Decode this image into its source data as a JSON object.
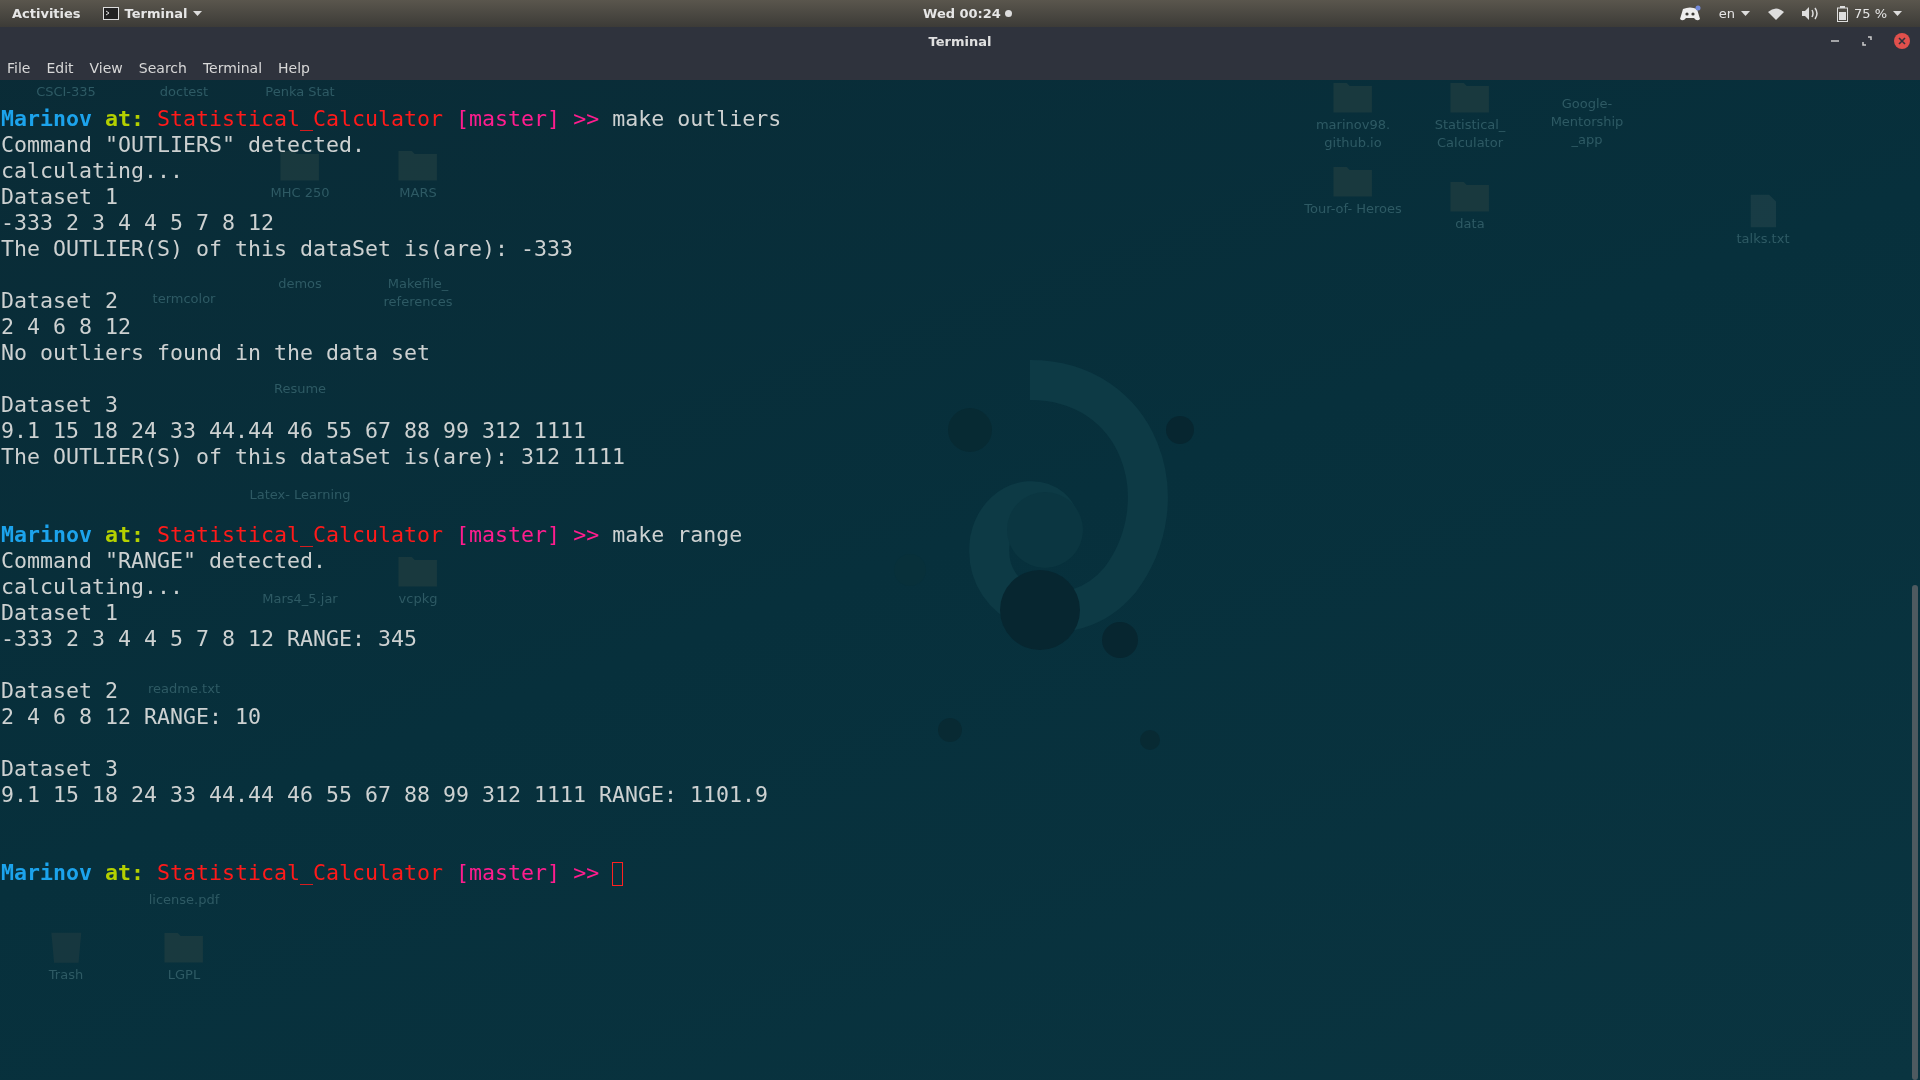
{
  "top_bar": {
    "activities": "Activities",
    "app_menu": "Terminal",
    "clock": "Wed 00:24",
    "keyboard_layout": "en",
    "battery": "75 %"
  },
  "window": {
    "title": "Terminal",
    "menu": [
      "File",
      "Edit",
      "View",
      "Search",
      "Terminal",
      "Help"
    ]
  },
  "terminal": {
    "lines": [
      {
        "kind": "prompt",
        "user": "Marinov",
        "at": "at:",
        "directory": "Statistical_Calculator",
        "branch": "[master]",
        "arrow": ">>",
        "command": "make outliers"
      },
      {
        "kind": "output",
        "text": "Command \"OUTLIERS\" detected."
      },
      {
        "kind": "output",
        "text": "calculating..."
      },
      {
        "kind": "output",
        "text": "Dataset 1"
      },
      {
        "kind": "output",
        "text": "-333 2 3 4 4 5 7 8 12"
      },
      {
        "kind": "output",
        "text": "The OUTLIER(S) of this dataSet is(are): -333"
      },
      {
        "kind": "blank"
      },
      {
        "kind": "output",
        "text": "Dataset 2"
      },
      {
        "kind": "output",
        "text": "2 4 6 8 12"
      },
      {
        "kind": "output",
        "text": "No outliers found in the data set"
      },
      {
        "kind": "blank"
      },
      {
        "kind": "output",
        "text": "Dataset 3"
      },
      {
        "kind": "output",
        "text": "9.1 15 18 24 33 44.44 46 55 67 88 99 312 1111"
      },
      {
        "kind": "output",
        "text": "The OUTLIER(S) of this dataSet is(are): 312 1111"
      },
      {
        "kind": "blank"
      },
      {
        "kind": "blank"
      },
      {
        "kind": "prompt",
        "user": "Marinov",
        "at": "at:",
        "directory": "Statistical_Calculator",
        "branch": "[master]",
        "arrow": ">>",
        "command": "make range"
      },
      {
        "kind": "output",
        "text": "Command \"RANGE\" detected."
      },
      {
        "kind": "output",
        "text": "calculating..."
      },
      {
        "kind": "output",
        "text": "Dataset 1"
      },
      {
        "kind": "output",
        "text": "-333 2 3 4 4 5 7 8 12 RANGE: 345"
      },
      {
        "kind": "blank"
      },
      {
        "kind": "output",
        "text": "Dataset 2"
      },
      {
        "kind": "output",
        "text": "2 4 6 8 12 RANGE: 10"
      },
      {
        "kind": "blank"
      },
      {
        "kind": "output",
        "text": "Dataset 3"
      },
      {
        "kind": "output",
        "text": "9.1 15 18 24 33 44.44 46 55 67 88 99 312 1111 RANGE: 1101.9"
      },
      {
        "kind": "blank"
      },
      {
        "kind": "blank"
      },
      {
        "kind": "prompt",
        "user": "Marinov",
        "at": "at:",
        "directory": "Statistical_Calculator",
        "branch": "[master]",
        "arrow": ">>",
        "cursor": true
      }
    ]
  },
  "desktop": {
    "icons": [
      {
        "label": "CSCI-335",
        "kind": "label"
      },
      {
        "label": "doctest",
        "kind": "label"
      },
      {
        "label": "Penka Stat",
        "kind": "label"
      },
      {
        "label": "MHC 250",
        "kind": "folder"
      },
      {
        "label": "MARS",
        "kind": "folder"
      },
      {
        "label": "termcolor",
        "kind": "label"
      },
      {
        "label": "demos",
        "kind": "label"
      },
      {
        "label": "Makefile_ references",
        "kind": "label"
      },
      {
        "label": "Resume",
        "kind": "label"
      },
      {
        "label": "Latex- Learning",
        "kind": "label"
      },
      {
        "label": "Mars4_5.jar",
        "kind": "label"
      },
      {
        "label": "vcpkg",
        "kind": "folder"
      },
      {
        "label": "readme.txt",
        "kind": "label"
      },
      {
        "label": "license.pdf",
        "kind": "label"
      },
      {
        "label": "Trash",
        "kind": "trash"
      },
      {
        "label": "LGPL",
        "kind": "folder"
      },
      {
        "label": "marinov98. github.io",
        "kind": "folder"
      },
      {
        "label": "Statistical_ Calculator",
        "kind": "folder"
      },
      {
        "label": "Google- Mentorship _app",
        "kind": "label"
      },
      {
        "label": "Tour-of- Heroes",
        "kind": "folder"
      },
      {
        "label": "data",
        "kind": "folder"
      },
      {
        "label": "talks.txt",
        "kind": "document"
      }
    ]
  }
}
